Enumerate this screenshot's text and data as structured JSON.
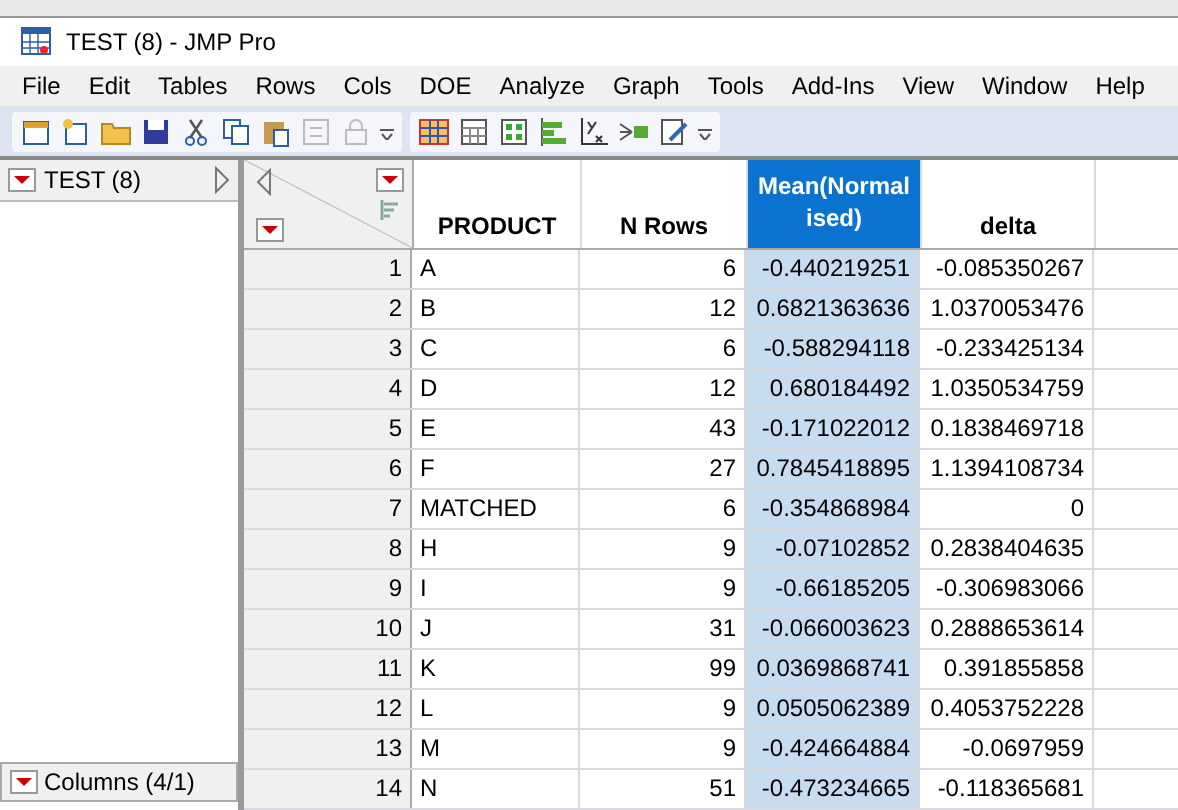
{
  "window": {
    "title": "TEST (8) - JMP Pro"
  },
  "menu": [
    "File",
    "Edit",
    "Tables",
    "Rows",
    "Cols",
    "DOE",
    "Analyze",
    "Graph",
    "Tools",
    "Add-Ins",
    "View",
    "Window",
    "Help"
  ],
  "table_panel": {
    "name": "TEST (8)"
  },
  "columns_panel": {
    "label": "Columns (4/1)"
  },
  "table": {
    "columns": [
      {
        "name": "PRODUCT",
        "selected": false
      },
      {
        "name": "N Rows",
        "selected": false
      },
      {
        "name": "Mean(Normalised)",
        "selected": true
      },
      {
        "name": "delta",
        "selected": false
      }
    ],
    "rows": [
      {
        "number": "1",
        "cells": [
          "A",
          "6",
          "-0.440219251",
          "-0.085350267"
        ]
      },
      {
        "number": "2",
        "cells": [
          "B",
          "12",
          "0.6821363636",
          "1.0370053476"
        ]
      },
      {
        "number": "3",
        "cells": [
          "C",
          "6",
          "-0.588294118",
          "-0.233425134"
        ]
      },
      {
        "number": "4",
        "cells": [
          "D",
          "12",
          "0.680184492",
          "1.0350534759"
        ]
      },
      {
        "number": "5",
        "cells": [
          "E",
          "43",
          "-0.171022012",
          "0.1838469718"
        ]
      },
      {
        "number": "6",
        "cells": [
          "F",
          "27",
          "0.7845418895",
          "1.1394108734"
        ]
      },
      {
        "number": "7",
        "cells": [
          "MATCHED",
          "6",
          "-0.354868984",
          "0"
        ]
      },
      {
        "number": "8",
        "cells": [
          "H",
          "9",
          "-0.07102852",
          "0.2838404635"
        ]
      },
      {
        "number": "9",
        "cells": [
          "I",
          "9",
          "-0.66185205",
          "-0.306983066"
        ]
      },
      {
        "number": "10",
        "cells": [
          "J",
          "31",
          "-0.066003623",
          "0.2888653614"
        ]
      },
      {
        "number": "11",
        "cells": [
          "K",
          "99",
          "0.0369868741",
          "0.391855858"
        ]
      },
      {
        "number": "12",
        "cells": [
          "L",
          "9",
          "0.0505062389",
          "0.4053752228"
        ]
      },
      {
        "number": "13",
        "cells": [
          "M",
          "9",
          "-0.424664884",
          "-0.0697959"
        ]
      },
      {
        "number": "14",
        "cells": [
          "N",
          "51",
          "-0.473234665",
          "-0.118365681"
        ]
      }
    ]
  }
}
